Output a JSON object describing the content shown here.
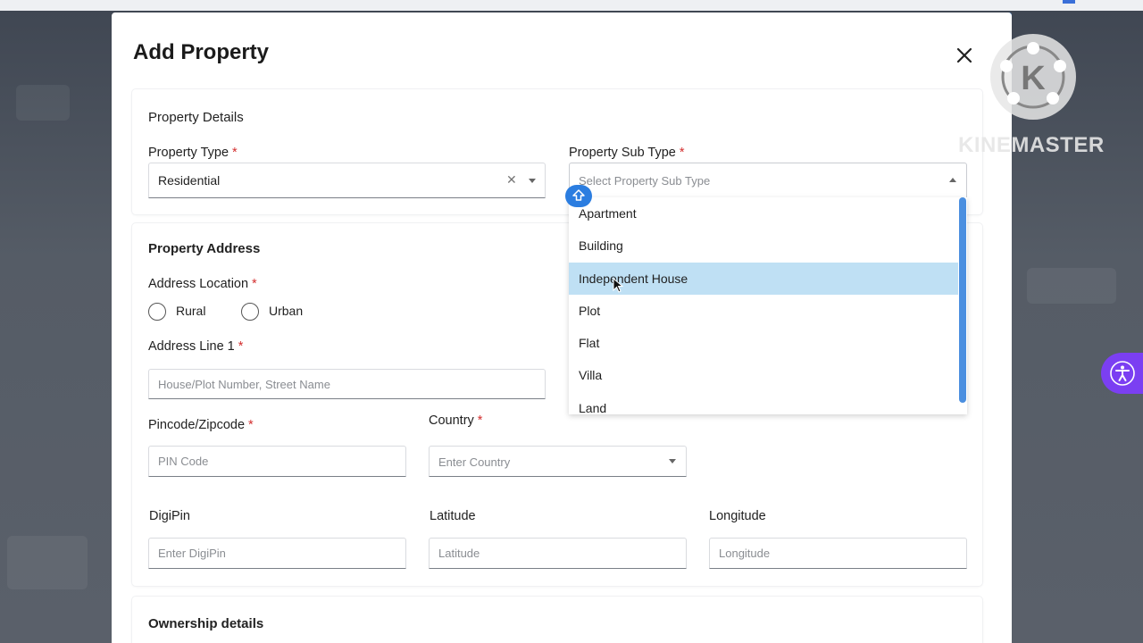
{
  "modal": {
    "title": "Add Property",
    "close_icon": "close-icon"
  },
  "property_details": {
    "heading": "Property Details",
    "property_type": {
      "label": "Property Type",
      "required": "*",
      "value": "Residential"
    },
    "property_sub_type": {
      "label": "Property Sub Type",
      "required": "*",
      "placeholder": "Select Property Sub Type",
      "options": [
        "Apartment",
        "Building",
        "Independent House",
        "Plot",
        "Flat",
        "Villa",
        "Land"
      ],
      "highlighted": "Independent House"
    }
  },
  "property_address": {
    "heading": "Property Address",
    "address_location": {
      "label": "Address Location",
      "required": "*",
      "options": [
        "Rural",
        "Urban"
      ]
    },
    "address_line_1": {
      "label": "Address Line 1",
      "required": "*",
      "placeholder": "House/Plot Number, Street Name"
    },
    "pincode": {
      "label": "Pincode/Zipcode",
      "required": "*",
      "placeholder": "PIN Code"
    },
    "country": {
      "label": "Country",
      "required": "*",
      "placeholder": "Enter Country"
    },
    "digipin": {
      "label": "DigiPin",
      "placeholder": "Enter DigiPin"
    },
    "latitude": {
      "label": "Latitude",
      "placeholder": "Latitude"
    },
    "longitude": {
      "label": "Longitude",
      "placeholder": "Longitude"
    }
  },
  "ownership": {
    "heading": "Ownership details"
  },
  "watermark": {
    "logo_letter": "K",
    "text": "KINEMASTER"
  },
  "colors": {
    "accent": "#4b8fe0",
    "highlight": "#bfe0f4",
    "required": "#d32f2f",
    "accessibility": "#7b3ff2"
  }
}
